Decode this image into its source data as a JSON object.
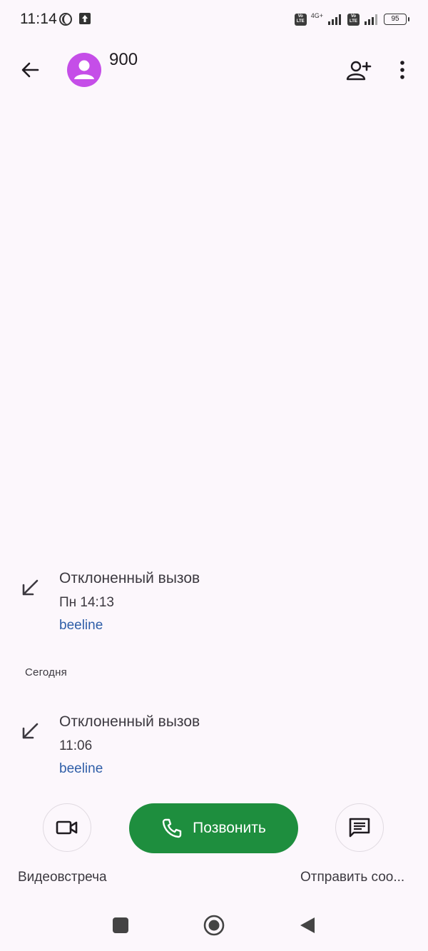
{
  "status_bar": {
    "time": "11:14",
    "network_label": "4G+",
    "volte_label_top": "Vo",
    "volte_label_bottom": "LTE",
    "battery": "95"
  },
  "header": {
    "contact_name": "900",
    "avatar_color": "#c54ee8"
  },
  "call_history": {
    "entries": [
      {
        "type": "Отклоненный вызов",
        "time": "Пн 14:13",
        "carrier": "beeline"
      },
      {
        "type": "Отклоненный вызов",
        "time": "11:06",
        "carrier": "beeline"
      }
    ],
    "today_header": "Сегодня"
  },
  "actions": {
    "video_label": "Видеовстреча",
    "call_label": "Позвонить",
    "message_label": "Отправить соо..."
  },
  "colors": {
    "call_button": "#1e8e3e",
    "carrier_link": "#2f5ea8",
    "background": "#fcf7fc"
  }
}
